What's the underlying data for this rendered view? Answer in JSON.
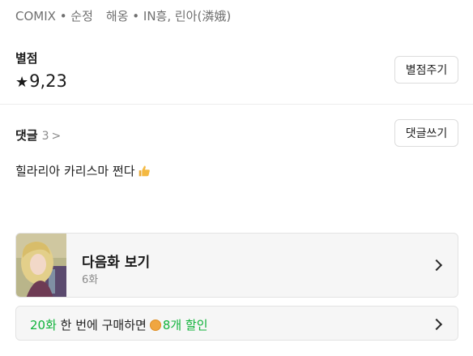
{
  "meta": {
    "type": "COMIX • 순정",
    "authors": "해옹 • IN흥, 린아(潾娥)"
  },
  "rating": {
    "title": "별점",
    "star": "★",
    "value": "9,23",
    "button_label": "별점주기"
  },
  "comments": {
    "title": "댓글",
    "count": "3",
    "chevron": ">",
    "button_label": "댓글쓰기",
    "top_comment": "힐라리아 카리스마 쩐다"
  },
  "next_episode": {
    "title": "다음화 보기",
    "subtitle": "6화"
  },
  "promo": {
    "episodes": "20화",
    "text1": "한 번에 구매하면",
    "discount": "8개 할인"
  },
  "colors": {
    "accent_green": "#12b33c",
    "coin": "#f0a640"
  }
}
